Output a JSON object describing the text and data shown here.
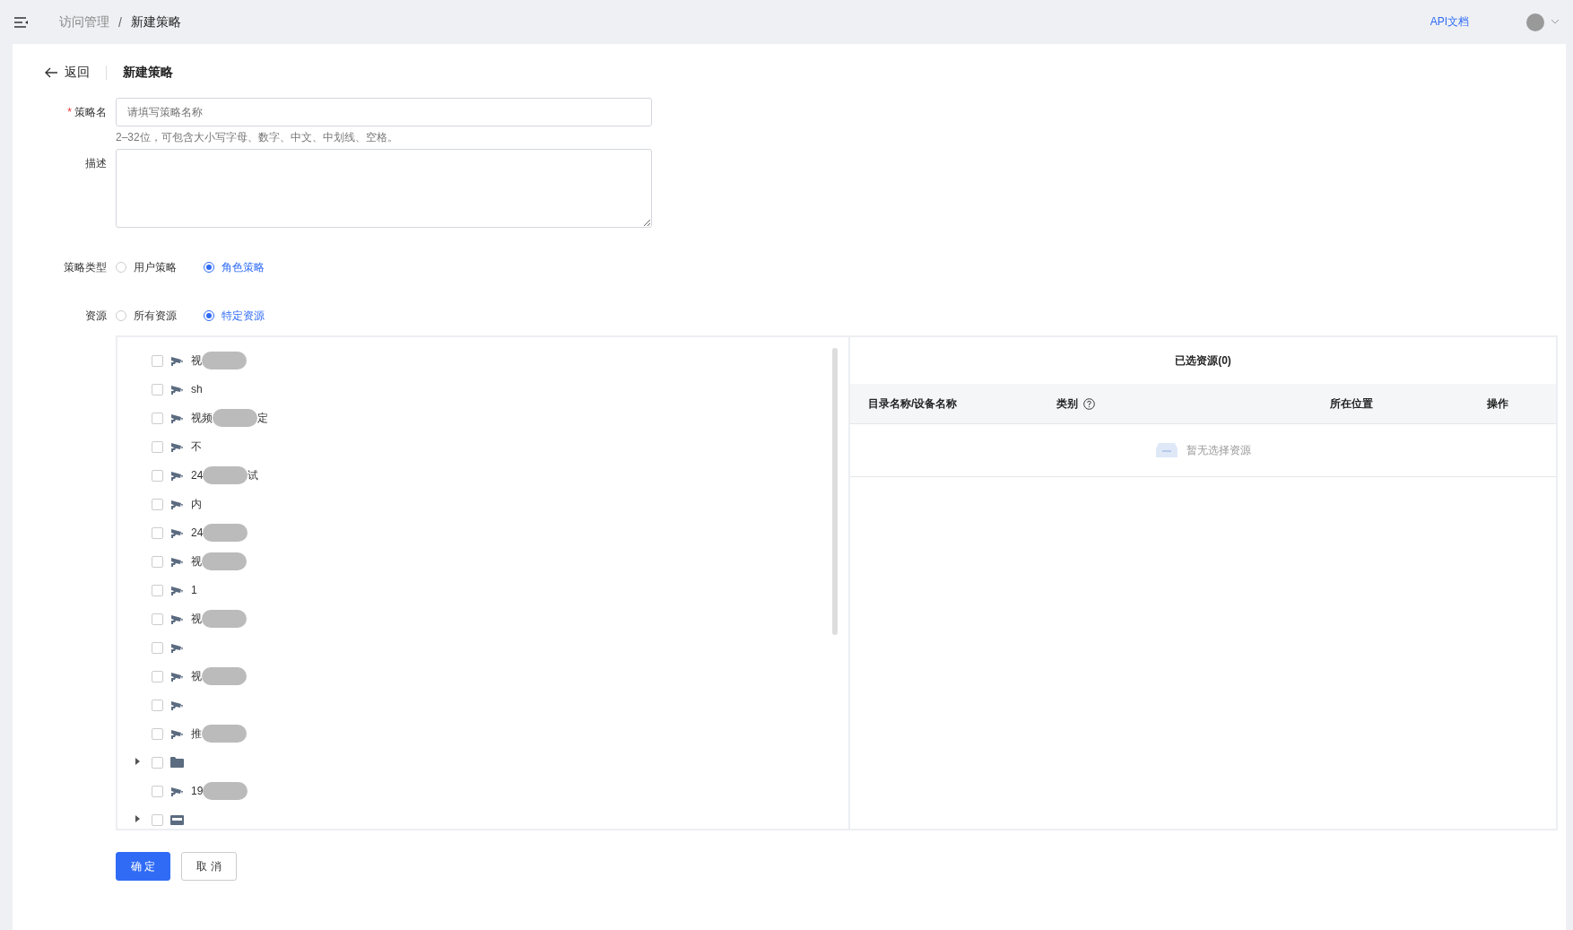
{
  "topbar": {
    "breadcrumb": [
      "访问管理",
      "新建策略"
    ],
    "separator": "/",
    "api_link": "API文档"
  },
  "header": {
    "back": "返回",
    "title": "新建策略"
  },
  "form": {
    "name": {
      "label": "策略名",
      "required_mark": "*",
      "placeholder": "请填写策略名称",
      "hint": "2–32位，可包含大小写字母、数字、中文、中划线、空格。"
    },
    "description": {
      "label": "描述"
    },
    "policy_type": {
      "label": "策略类型",
      "options": [
        {
          "label": "用户策略",
          "selected": false
        },
        {
          "label": "角色策略",
          "selected": true
        }
      ]
    },
    "resource": {
      "label": "资源",
      "options": [
        {
          "label": "所有资源",
          "selected": false
        },
        {
          "label": "特定资源",
          "selected": true
        }
      ]
    }
  },
  "tree": [
    {
      "kind": "camera",
      "text": "视",
      "masked": true,
      "expandable": false,
      "checked": false
    },
    {
      "kind": "camera",
      "text": "sh",
      "masked": false,
      "expandable": false,
      "checked": false
    },
    {
      "kind": "camera",
      "text": "视频",
      "masked": true,
      "tail": "定",
      "expandable": false,
      "checked": false
    },
    {
      "kind": "camera",
      "text": "不",
      "masked": false,
      "expandable": false,
      "checked": false
    },
    {
      "kind": "camera",
      "text": "24",
      "masked": true,
      "tail": "试",
      "expandable": false,
      "checked": false
    },
    {
      "kind": "camera",
      "text": "内",
      "masked": false,
      "expandable": false,
      "checked": false
    },
    {
      "kind": "camera",
      "text": "24",
      "masked": true,
      "expandable": false,
      "checked": false
    },
    {
      "kind": "camera",
      "text": "视",
      "masked": true,
      "expandable": false,
      "checked": false
    },
    {
      "kind": "camera",
      "text": "1",
      "masked": false,
      "expandable": false,
      "checked": false
    },
    {
      "kind": "camera",
      "text": "视",
      "masked": true,
      "expandable": false,
      "checked": false
    },
    {
      "kind": "camera",
      "masked": false,
      "expandable": false,
      "checked": false
    },
    {
      "kind": "camera",
      "text": "视",
      "masked": true,
      "expandable": false,
      "checked": false
    },
    {
      "kind": "camera",
      "masked": false,
      "expandable": false,
      "checked": false
    },
    {
      "kind": "camera",
      "text": "推",
      "masked": true,
      "expandable": false,
      "checked": false
    },
    {
      "kind": "folder",
      "masked": false,
      "expandable": true,
      "checked": false
    },
    {
      "kind": "camera",
      "text": "19",
      "masked": true,
      "expandable": false,
      "checked": false
    },
    {
      "kind": "recorder",
      "masked": false,
      "expandable": true,
      "checked": false
    }
  ],
  "selected_panel": {
    "title": "已选资源(0)",
    "columns": [
      "目录名称/设备名称",
      "类别",
      "所在位置",
      "操作"
    ],
    "empty": "暂无选择资源"
  },
  "buttons": [
    {
      "label": "确 定",
      "kind": "primary"
    },
    {
      "label": "取 消",
      "kind": "default"
    }
  ]
}
